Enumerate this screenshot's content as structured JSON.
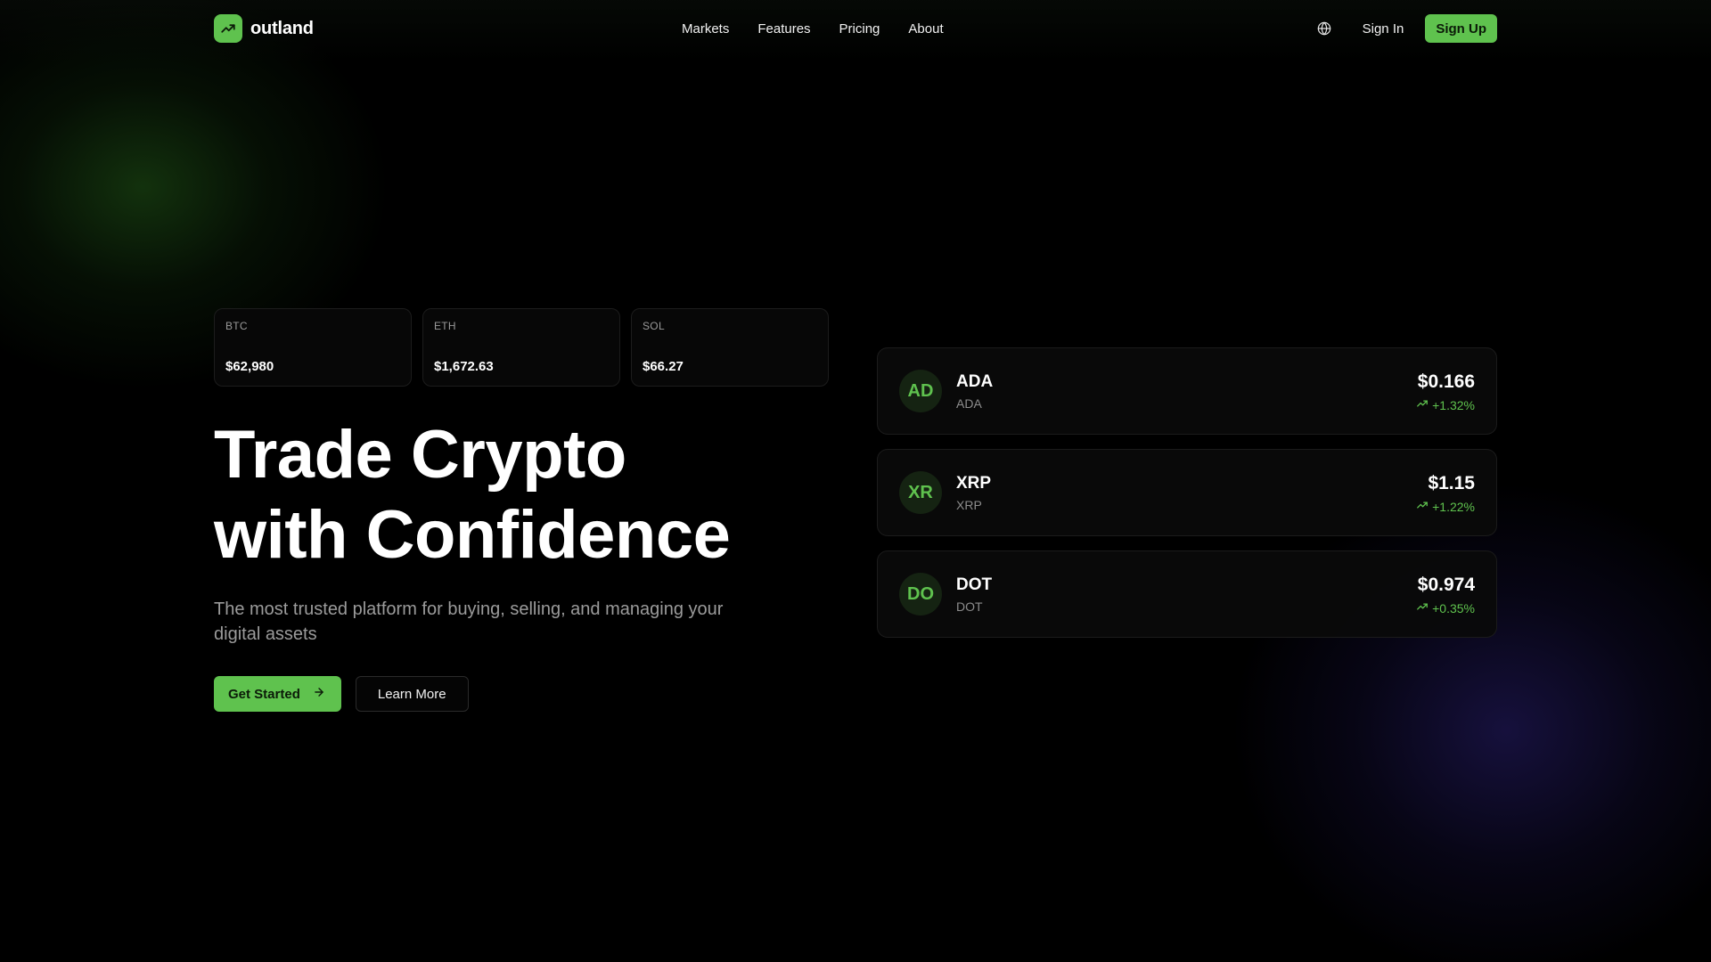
{
  "brand": {
    "name": "outland",
    "icon": "trending-up-icon"
  },
  "nav": {
    "links": [
      {
        "label": "Markets"
      },
      {
        "label": "Features"
      },
      {
        "label": "Pricing"
      },
      {
        "label": "About"
      }
    ],
    "language_icon": "globe-icon",
    "sign_in": "Sign In",
    "sign_up": "Sign Up"
  },
  "tickers": [
    {
      "symbol": "BTC",
      "price": "$62,980"
    },
    {
      "symbol": "ETH",
      "price": "$1,672.63"
    },
    {
      "symbol": "SOL",
      "price": "$66.27"
    }
  ],
  "hero": {
    "title_line1": "Trade Crypto",
    "title_line2": "with Confidence",
    "subtitle": "The most trusted platform for buying, selling, and managing your digital assets",
    "primary_cta": "Get Started",
    "secondary_cta": "Learn More"
  },
  "assets": [
    {
      "avatar": "AD",
      "name": "ADA",
      "symbol": "ADA",
      "price": "$0.166",
      "change": "+1.32%"
    },
    {
      "avatar": "XR",
      "name": "XRP",
      "symbol": "XRP",
      "price": "$1.15",
      "change": "+1.22%"
    },
    {
      "avatar": "DO",
      "name": "DOT",
      "symbol": "DOT",
      "price": "$0.974",
      "change": "+0.35%"
    }
  ],
  "colors": {
    "accent": "#5fc24e",
    "background": "#000000",
    "muted_text": "#9b9b9b"
  }
}
